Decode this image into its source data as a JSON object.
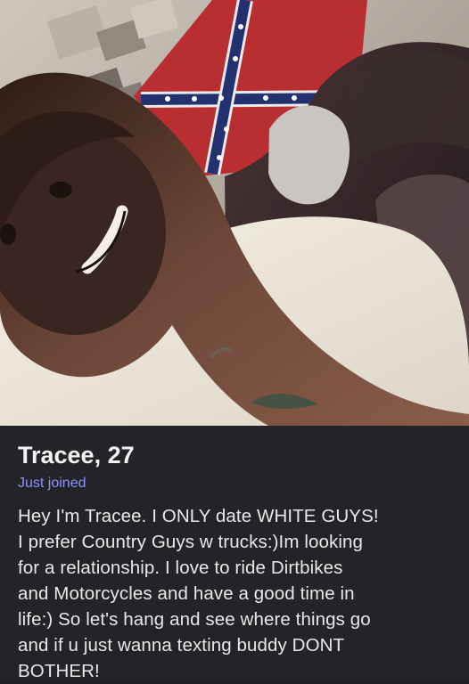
{
  "profile": {
    "name_age": "Tracee, 27",
    "status": "Just joined",
    "bio": "Hey I'm Tracee. I ONLY date WHITE GUYS!\nI prefer Country Guys w trucks:)Im looking\nfor a relationship. I love to ride Dirtbikes\nand Motorcycles and have a good time in\nlife:) So let's hang and see where things go\nand if u just wanna texting buddy DONT\nBOTHER!"
  },
  "colors": {
    "card_background": "#232428",
    "status_accent": "#8d90ff",
    "text_primary": "#f4f4f4"
  }
}
